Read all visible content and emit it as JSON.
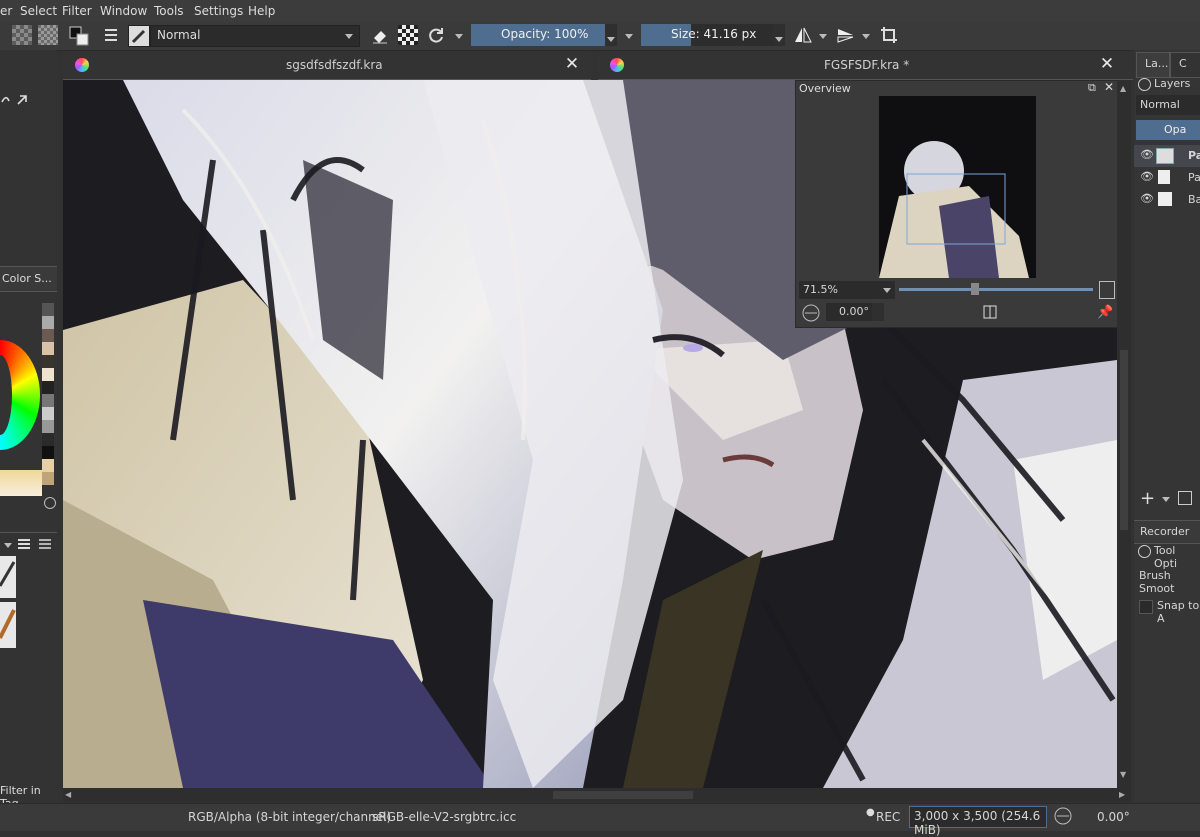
{
  "menu": [
    "er",
    "Select",
    "Filter",
    "Window",
    "Tools",
    "Settings",
    "Help"
  ],
  "toolbar": {
    "blend_mode": "Normal",
    "opacity_label": "Opacity: 100%",
    "opacity_value": 1.0,
    "size_label": "Size: 41.16 px"
  },
  "tabs": [
    {
      "title": "sgsdfsdfszdf.kra"
    },
    {
      "title": "FGSFSDF.kra *"
    }
  ],
  "overview": {
    "title": "Overview",
    "zoom": "71.5%",
    "rotation": "0.00°"
  },
  "left_dock": {
    "color_tab": "Color S...",
    "filter_tag": "Filter in Tag"
  },
  "right_dock": {
    "tab_layers": "La...",
    "tab_other": "C",
    "layers_title": "Layers",
    "blend_mode": "Normal",
    "opacity_tab": "Opa",
    "layers": [
      {
        "name": "Pa",
        "visible": true,
        "active": true
      },
      {
        "name": "Pa",
        "visible": true,
        "active": false
      },
      {
        "name": "Ba",
        "visible": true,
        "active": false
      }
    ],
    "recorder": "Recorder",
    "tool_options": "Tool Opti",
    "brush_smoothing": "Brush Smoot",
    "snap_to": "Snap to A"
  },
  "status": {
    "color_space": "RGB/Alpha (8-bit integer/channel)",
    "profile": "sRGB-elle-V2-srgbtrc.icc",
    "rec": "REC",
    "image_size": "3,000 x 3,500 (254.6 MiB)",
    "rotation": "0.00°"
  },
  "colors": {
    "accent": "#4f6d8e",
    "panel": "#323232",
    "canvas_bg": "#1c1b1f"
  }
}
